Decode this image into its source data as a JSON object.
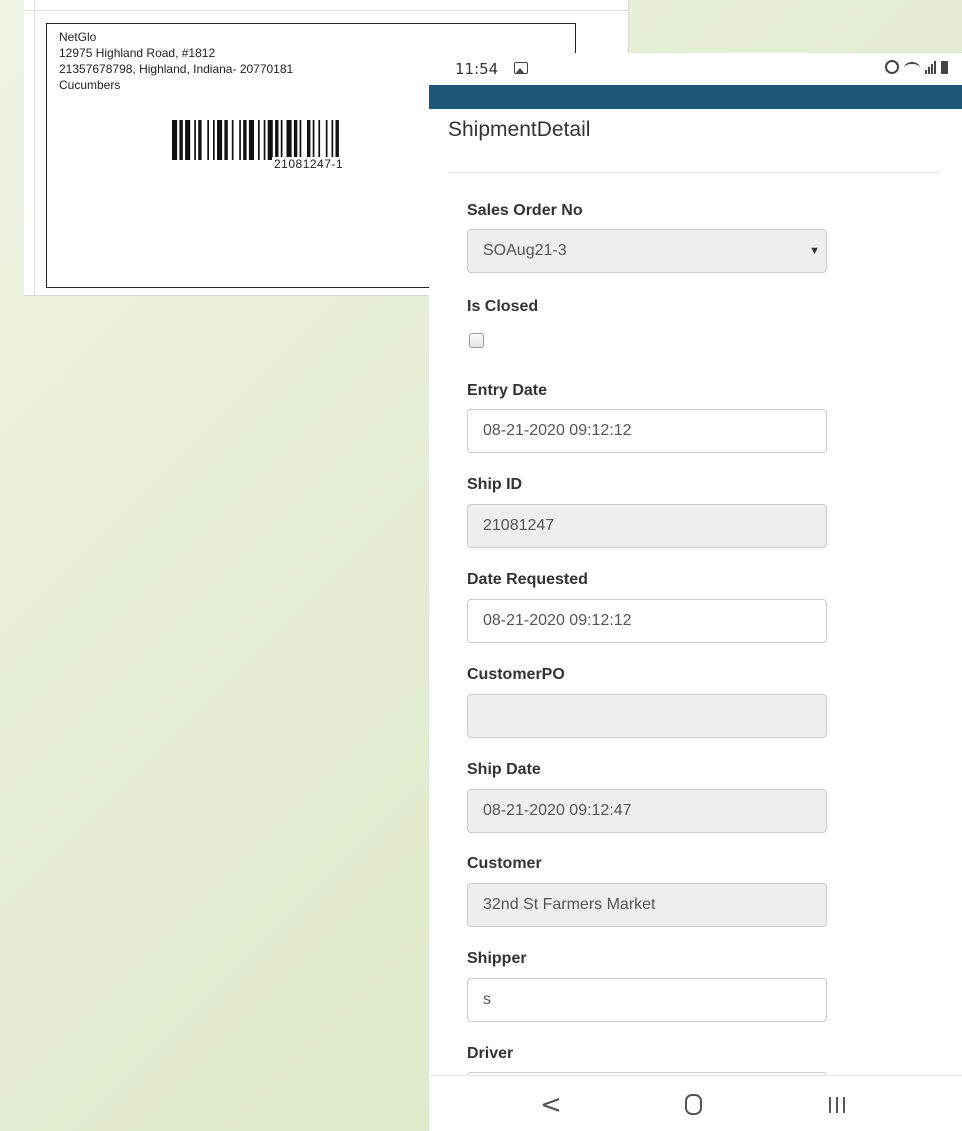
{
  "label": {
    "company": "NetGlo",
    "address_line1": "12975 Highland Road, #1812",
    "address_line2": "21357678798, Highland, Indiana- 20770181",
    "product": "Cucumbers",
    "barcode_number": "21081247-1"
  },
  "status_bar": {
    "time": "11:54"
  },
  "page": {
    "title": "ShipmentDetail"
  },
  "fields": {
    "sales_order_no": {
      "label": "Sales Order No",
      "value": "SOAug21-3"
    },
    "is_closed": {
      "label": "Is Closed",
      "checked": false
    },
    "entry_date": {
      "label": "Entry Date",
      "value": "08-21-2020 09:12:12"
    },
    "ship_id": {
      "label": "Ship ID",
      "value": "21081247"
    },
    "date_requested": {
      "label": "Date Requested",
      "value": "08-21-2020 09:12:12"
    },
    "customer_po": {
      "label": "CustomerPO",
      "value": ""
    },
    "ship_date": {
      "label": "Ship Date",
      "value": "08-21-2020 09:12:47"
    },
    "customer": {
      "label": "Customer",
      "value": "32nd St Farmers Market"
    },
    "shipper": {
      "label": "Shipper",
      "value": "s"
    },
    "driver": {
      "label": "Driver",
      "value": ""
    }
  },
  "nav": {
    "back": "<",
    "home_icon": "home-icon",
    "recent_icon": "recent-apps-icon"
  },
  "colors": {
    "appbar": "#1f5876",
    "readonly_field": "#eeeeee"
  }
}
